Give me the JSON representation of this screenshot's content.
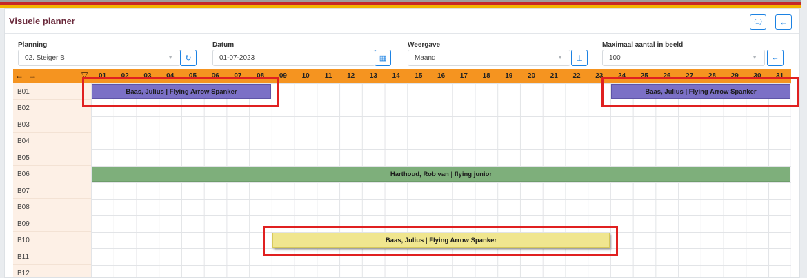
{
  "header": {
    "title": "Visuele planner"
  },
  "icons": {
    "comment": "comment-icon",
    "back": "arrow-left-icon"
  },
  "filters": {
    "planning": {
      "label": "Planning",
      "value": "02. Steiger B"
    },
    "datum": {
      "label": "Datum",
      "value": "01-07-2023"
    },
    "weergave": {
      "label": "Weergave",
      "value": "Maand"
    },
    "max": {
      "label": "Maximaal aantal in beeld",
      "value": "100"
    }
  },
  "planner": {
    "days": [
      "01",
      "02",
      "03",
      "04",
      "05",
      "06",
      "07",
      "08",
      "09",
      "10",
      "11",
      "12",
      "13",
      "14",
      "15",
      "16",
      "17",
      "18",
      "19",
      "20",
      "21",
      "22",
      "23",
      "24",
      "25",
      "26",
      "27",
      "28",
      "29",
      "30",
      "31"
    ],
    "rows": [
      "B01",
      "B02",
      "B03",
      "B04",
      "B05",
      "B06",
      "B07",
      "B08",
      "B09",
      "B10",
      "B11",
      "B12"
    ],
    "bookings": [
      {
        "row": 0,
        "start": 1,
        "end": 8,
        "label": "Baas, Julius | Flying Arrow Spanker",
        "color": "purple",
        "highlight": true
      },
      {
        "row": 0,
        "start": 24,
        "end": 31,
        "label": "Baas, Julius | Flying Arrow Spanker",
        "color": "purple",
        "highlight": true
      },
      {
        "row": 5,
        "start": 1,
        "end": 31,
        "label": "Harthoud, Rob van | flying junior",
        "color": "green",
        "highlight": false
      },
      {
        "row": 9,
        "start": 9,
        "end": 23,
        "label": "Baas, Julius | Flying Arrow Spanker",
        "color": "yellow",
        "highlight": true
      }
    ]
  },
  "colors": {
    "axis": "#f59420",
    "highlight": "#e02020",
    "title": "#6a2a3c",
    "accent": "#1c82e3"
  }
}
